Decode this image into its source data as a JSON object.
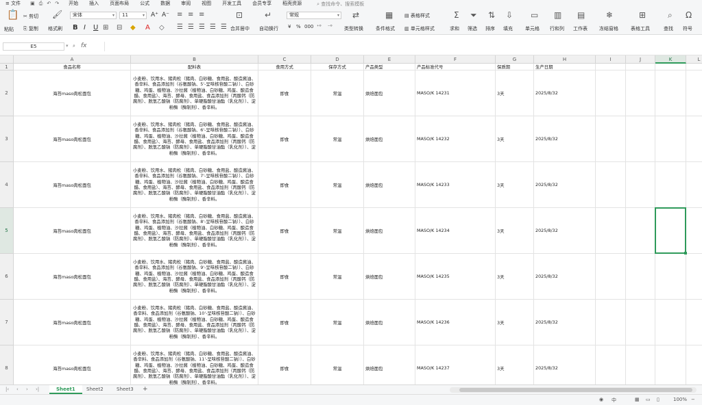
{
  "menubar": {
    "file": "文件",
    "tabs": [
      "开始",
      "插入",
      "页面布局",
      "公式",
      "数据",
      "审阅",
      "视图",
      "开发工具",
      "会员专享",
      "稻壳资源"
    ],
    "active_tab": "开始",
    "search": "查找命令、搜索模板"
  },
  "ribbon": {
    "paste": "粘贴",
    "cut": "剪切",
    "copy": "复制",
    "format_painter": "格式刷",
    "font_name": "宋体",
    "font_size": "11",
    "number_format": "常规",
    "merge": "合并居中",
    "wrap": "自动换行",
    "type_convert": "类型转换",
    "cond_format": "条件格式",
    "table_style": "表格样式",
    "cell_style": "单元格样式",
    "sum": "求和",
    "filter": "筛选",
    "sort": "排序",
    "fill": "填充",
    "cell": "单元格",
    "row_col": "行和列",
    "worksheet": "工作表",
    "freeze": "冻结窗格",
    "table_tools": "表格工具",
    "find": "查找",
    "symbol": "符号",
    "bold": "B",
    "italic": "I",
    "underline": "U",
    "percent": "%",
    "thousands": "000"
  },
  "formula_bar": {
    "name_box": "E5",
    "fx": "fx",
    "content": ""
  },
  "columns": [
    "A",
    "B",
    "C",
    "D",
    "E",
    "F",
    "G",
    "H",
    "I",
    "J",
    "K",
    "L"
  ],
  "selected_column": "K",
  "selected_row": "5",
  "headers": [
    "食品名称",
    "配料表",
    "食用方式",
    "保存方式",
    "产品类型",
    "产品标准代号",
    "保质期",
    "生产日期"
  ],
  "rows": [
    {
      "num": "2",
      "name": "海苔maso肉松面包",
      "ingredients": "小麦粉、饮用水、猪肉松（猪肉、白砂糖、食用盐、酿造酱油、香辛料、食品添加剂（谷氨酸钠、5'-呈味核苷酸二钠））、白砂糖、鸡蛋、植物油、沙拉酱（植物油、白砂糖、鸡蛋、酿造食醋、食用盐）、海苔、酵母、食用盐、食品添加剂（丙酸钙（防腐剂）、脱氢乙酸钠（防腐剂）、单硬脂酸甘油酯（乳化剂））、淀粉酶（酶制剂）、香辛料。",
      "method": "即食",
      "storage": "常温",
      "type": "烘焙面包",
      "std": "MASO/K 14231",
      "shelf": "3天",
      "date": "2025/8/32"
    },
    {
      "num": "3",
      "name": "海苔maso肉松面包",
      "ingredients": "小麦粉、饮用水、猪肉松（猪肉、白砂糖、食用盐、酿造酱油、香辛料、食品添加剂（谷氨酸钠、6'-呈味核苷酸二钠））、白砂糖、鸡蛋、植物油、沙拉酱（植物油、白砂糖、鸡蛋、酿造食醋、食用盐）、海苔、酵母、食用盐、食品添加剂（丙酸钙（防腐剂）、脱氢乙酸钠（防腐剂）、单硬脂酸甘油酯（乳化剂））、淀粉酶（酶制剂）、香辛料。",
      "method": "即食",
      "storage": "常温",
      "type": "烘焙面包",
      "std": "MASO/K 14232",
      "shelf": "3天",
      "date": "2025/8/32"
    },
    {
      "num": "4",
      "name": "海苔maso肉松面包",
      "ingredients": "小麦粉、饮用水、猪肉松（猪肉、白砂糖、食用盐、酿造酱油、香辛料、食品添加剂（谷氨酸钠、7'-呈味核苷酸二钠））、白砂糖、鸡蛋、植物油、沙拉酱（植物油、白砂糖、鸡蛋、酿造食醋、食用盐）、海苔、酵母、食用盐、食品添加剂（丙酸钙（防腐剂）、脱氢乙酸钠（防腐剂）、单硬脂酸甘油酯（乳化剂））、淀粉酶（酶制剂）、香辛料。",
      "method": "即食",
      "storage": "常温",
      "type": "烘焙面包",
      "std": "MASO/K 14233",
      "shelf": "3天",
      "date": "2025/8/32"
    },
    {
      "num": "5",
      "name": "海苔maso肉松面包",
      "ingredients": "小麦粉、饮用水、猪肉松（猪肉、白砂糖、食用盐、酿造酱油、香辛料、食品添加剂（谷氨酸钠、8'-呈味核苷酸二钠））、白砂糖、鸡蛋、植物油、沙拉酱（植物油、白砂糖、鸡蛋、酿造食醋、食用盐）、海苔、酵母、食用盐、食品添加剂（丙酸钙（防腐剂）、脱氢乙酸钠（防腐剂）、单硬脂酸甘油酯（乳化剂））、淀粉酶（酶制剂）、香辛料。",
      "method": "即食",
      "storage": "常温",
      "type": "烘焙面包",
      "std": "MASO/K 14234",
      "shelf": "3天",
      "date": "2025/8/32"
    },
    {
      "num": "6",
      "name": "海苔maso肉松面包",
      "ingredients": "小麦粉、饮用水、猪肉松（猪肉、白砂糖、食用盐、酿造酱油、香辛料、食品添加剂（谷氨酸钠、9'-呈味核苷酸二钠））、白砂糖、鸡蛋、植物油、沙拉酱（植物油、白砂糖、鸡蛋、酿造食醋、食用盐）、海苔、酵母、食用盐、食品添加剂（丙酸钙（防腐剂）、脱氢乙酸钠（防腐剂）、单硬脂酸甘油酯（乳化剂））、淀粉酶（酶制剂）、香辛料。",
      "method": "即食",
      "storage": "常温",
      "type": "烘焙面包",
      "std": "MASO/K 14235",
      "shelf": "3天",
      "date": "2025/8/32"
    },
    {
      "num": "7",
      "name": "海苔maso肉松面包",
      "ingredients": "小麦粉、饮用水、猪肉松（猪肉、白砂糖、食用盐、酿造酱油、香辛料、食品添加剂（谷氨酸钠、10'-呈味核苷酸二钠））、白砂糖、鸡蛋、植物油、沙拉酱（植物油、白砂糖、鸡蛋、酿造食醋、食用盐）、海苔、酵母、食用盐、食品添加剂（丙酸钙（防腐剂）、脱氢乙酸钠（防腐剂）、单硬脂酸甘油酯（乳化剂））、淀粉酶（酶制剂）、香辛料。",
      "method": "即食",
      "storage": "常温",
      "type": "烘焙面包",
      "std": "MASO/K 14236",
      "shelf": "3天",
      "date": "2025/8/32"
    },
    {
      "num": "8",
      "name": "海苔maso肉松面包",
      "ingredients": "小麦粉、饮用水、猪肉松（猪肉、白砂糖、食用盐、酿造酱油、香辛料、食品添加剂（谷氨酸钠、11'-呈味核苷酸二钠））、白砂糖、鸡蛋、植物油、沙拉酱（植物油、白砂糖、鸡蛋、酿造食醋、食用盐）、海苔、酵母、食用盐、食品添加剂（丙酸钙（防腐剂）、脱氢乙酸钠（防腐剂）、单硬脂酸甘油酯（乳化剂））、淀粉酶（酶制剂）、香辛料。",
      "method": "即食",
      "storage": "常温",
      "type": "烘焙面包",
      "std": "MASO/K 14237",
      "shelf": "3天",
      "date": "2025/8/32"
    }
  ],
  "sheets": [
    "Sheet1",
    "Sheet2",
    "Sheet3"
  ],
  "active_sheet": "Sheet1",
  "add_sheet": "+",
  "status": {
    "zoom": "100%"
  },
  "accent": "#2e9a5a"
}
